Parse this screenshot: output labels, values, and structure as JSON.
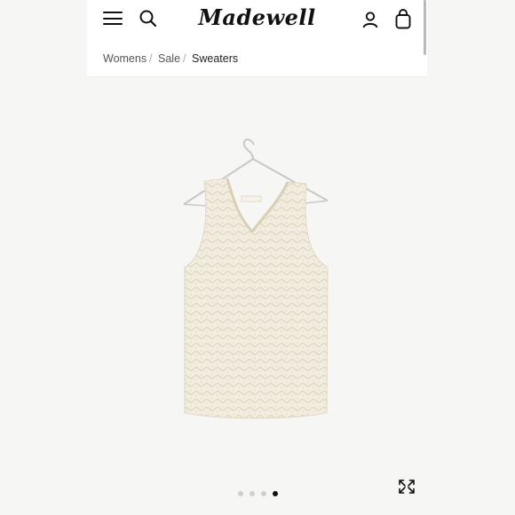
{
  "header": {
    "logo_text": "Madewell",
    "menu_icon": "hamburger-menu-icon",
    "search_icon": "search-icon",
    "account_icon": "user-icon",
    "bag_icon": "shopping-bag-icon"
  },
  "breadcrumb": {
    "items": [
      "Womens",
      "Sale",
      "Sweaters"
    ],
    "separator": "/"
  },
  "product": {
    "image_icon": "product-image",
    "expand_icon": "expand-icon"
  },
  "carousel": {
    "total": 4,
    "active_index": 3
  },
  "colors": {
    "background": "#f6f6f4",
    "header": "#ffffff",
    "text": "#111111",
    "product": "#f2ede0"
  }
}
